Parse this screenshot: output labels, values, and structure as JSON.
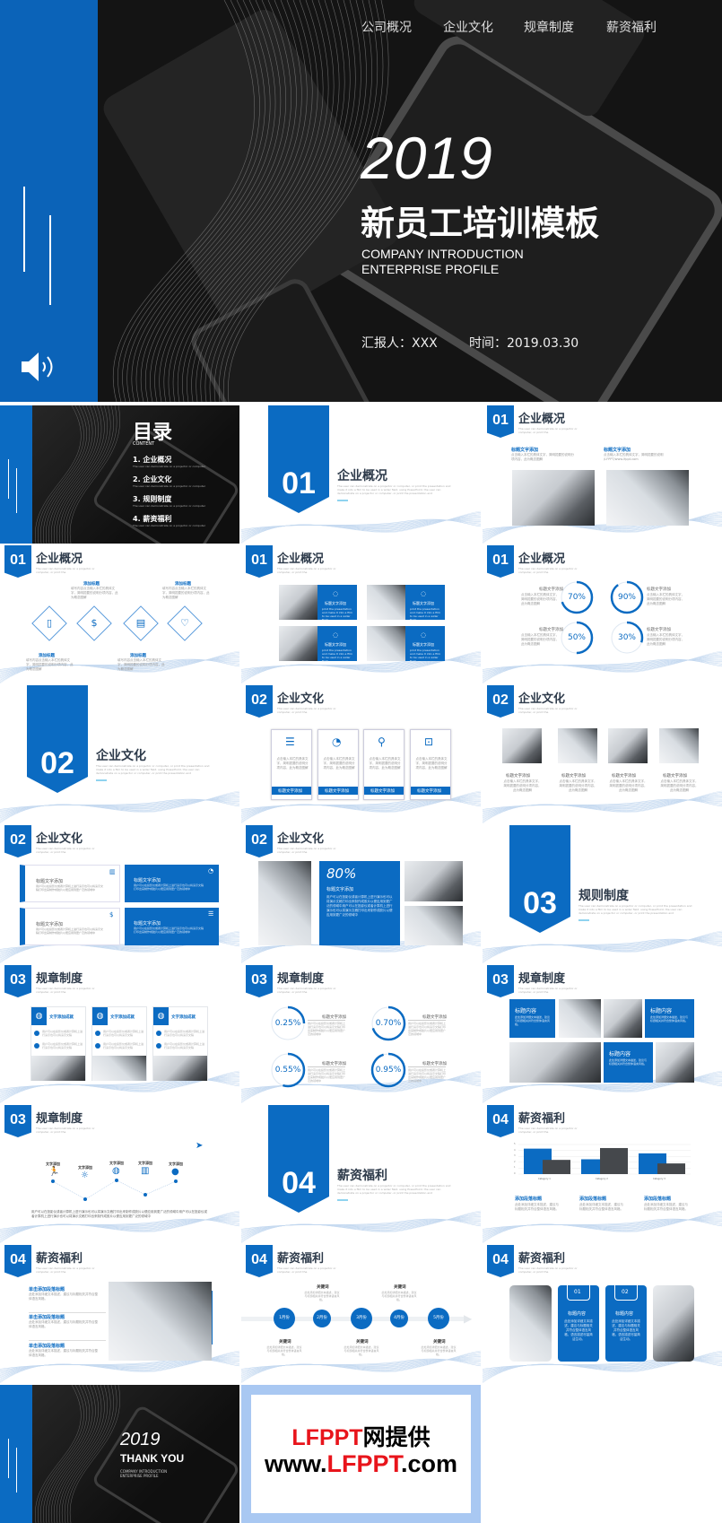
{
  "colors": {
    "accent": "#0b6bc2",
    "dark": "#141414",
    "chart_dark": "#45484c",
    "ad_red": "#e8141b",
    "ad_bg": "#a9c8f2"
  },
  "hero": {
    "nav": [
      "公司概况",
      "企业文化",
      "规章制度",
      "薪资福利"
    ],
    "year": "2019",
    "title": "新员工培训模板",
    "subtitle_1": "COMPANY INTRODUCTION",
    "subtitle_2": "ENTERPRISE PROFILE",
    "reporter": "汇报人：XXX",
    "time": "时间：2019.03.30",
    "audio_icon": "speaker-icon"
  },
  "slides": [
    {
      "type": "toc",
      "title": "目录",
      "subtitle": "CONTENT",
      "items": [
        {
          "label": "1. 企业概况",
          "desc": "The user can demonstrate on a projector or computer"
        },
        {
          "label": "2. 企业文化",
          "desc": "The user can demonstrate on a projector or computer"
        },
        {
          "label": "3. 规则制度",
          "desc": "The user can demonstrate on a projector or computer"
        },
        {
          "label": "4. 薪资福利",
          "desc": "The user can demonstrate on a projector or computer"
        }
      ]
    },
    {
      "type": "section",
      "num": "01",
      "title": "企业概况",
      "desc": "The user can demonstrate on a projector or computer, or print the presentation and make it into a film to be used in a wider field. using PowerPoint. the user can demonstrate on a projector or computer, or print the presentation and"
    },
    {
      "type": "two-col",
      "num": "01",
      "title": "企业概况",
      "subtitle": "The user can demonstrate on a projector or computer, or print the",
      "headings": [
        "标题文字添加",
        "标题文字添加"
      ],
      "texts": [
        "点击输入本栏的具体文字，简明扼要的说明分项内容，此为概念图解",
        "点击输入本栏的具体文字，简明扼要的说明 /LFPPT/www.lfppt.com"
      ]
    },
    {
      "type": "diamonds",
      "num": "01",
      "title": "企业概况",
      "subtitle": "The user can demonstrate on a projector or computer, or print the",
      "labels": [
        "添加标题",
        "添加标题",
        "添加标题",
        "添加标题"
      ],
      "text": "填写内容点击输入本栏的具体文字，简明扼要的说明分项内容，此为概念图解",
      "icons": [
        "phone-icon",
        "money-icon",
        "document-icon",
        "heart-icon"
      ]
    },
    {
      "type": "photo-boxes",
      "num": "01",
      "title": "企业概况",
      "subtitle": "The user can demonstrate on a projector or computer, or print the",
      "label": "标题文字添加",
      "text": "print the presentation and make it into a film to be used in a wider field"
    },
    {
      "type": "rings",
      "num": "01",
      "title": "企业概况",
      "subtitle": "The user can demonstrate on a projector or computer, or print the",
      "values": [
        70,
        90,
        50,
        30
      ],
      "labels": [
        "70%",
        "90%",
        "50%",
        "30%"
      ],
      "heading": "标题文字添加",
      "text": "点击输入本栏的具体文字，简明扼要的说明分项内容，此为概念图解"
    },
    {
      "type": "section",
      "num": "02",
      "title": "企业文化",
      "desc": "The user can demonstrate on a projector or computer, or print the presentation and make it into a film to be used in a wider field. using PowerPoint. the user can demonstrate on a projector or computer, or print the presentation and"
    },
    {
      "type": "cards",
      "num": "02",
      "title": "企业文化",
      "subtitle": "The user can demonstrate on a projector or computer, or print the",
      "label": "标题文字添加",
      "text": "点击输入本栏的具体文字，简明扼要的说明分项内容，此为概念图解",
      "icons": [
        "chat-icon",
        "clock-icon",
        "search-icon",
        "briefcase-icon"
      ]
    },
    {
      "type": "photo-labels",
      "num": "02",
      "title": "企业文化",
      "subtitle": "The user can demonstrate on a projector or computer, or print the",
      "label": "标题文字添加",
      "text": "点击输入本栏的具体文字，简明扼要的说明分项内容，此为概念图解"
    },
    {
      "type": "box-grid",
      "num": "02",
      "title": "企业文化",
      "subtitle": "The user can demonstrate on a projector or computer, or print the",
      "label": "标题文字添加",
      "text": "用户可以在投影仪或者计算机上进行演示也可以将演示文稿打印出来制作成胶片以便应用到更广泛的领域中"
    },
    {
      "type": "feature",
      "num": "02",
      "title": "企业文化",
      "subtitle": "The user can demonstrate on a projector or computer, or print the",
      "percent": "80%",
      "label": "标题文字添加",
      "text": "用户可以在投影仪或者计算机上进行演示也可以将演示文稿打印出来制作成胶片以便应用到更广泛的领域中用户可以在投影仪或者计算机上进行演示也可以将演示文稿打印出来制作成胶片以便应用到更广泛的领域中"
    },
    {
      "type": "section",
      "num": "03",
      "title": "规则制度",
      "desc": "The user can demonstrate on a projector or computer, or print the presentation and make it into a film to be used in a wider field. using PowerPoint. the user can demonstrate on a projector or computer, or print the presentation and"
    },
    {
      "type": "cards3",
      "num": "03",
      "title": "规章制度",
      "subtitle": "The user can demonstrate on a projector or computer, or print the",
      "labels": [
        "文字添加成就",
        "文字添加成就",
        "文字添加成就"
      ],
      "text": "用户可以在投影仪或者计算机上进行演示也可以将演示文稿"
    },
    {
      "type": "rings2",
      "num": "03",
      "title": "规章制度",
      "subtitle": "The user can demonstrate on a projector or computer, or print the",
      "values": [
        25,
        70,
        55,
        95
      ],
      "labels": [
        "0.25%",
        "0.70%",
        "0.55%",
        "0.95%"
      ],
      "heading": "标题文字添加",
      "text": "用户可以在投影仪或者计算机上进行演示也可以将演示文稿打印出来制作成胶片以便应用到更广泛的领域中"
    },
    {
      "type": "mosaic",
      "num": "03",
      "title": "规章制度",
      "subtitle": "The user can demonstrate on a projector or computer, or print the",
      "label": "标题内容",
      "text": "此处添加详细文本描述，建议与标题相关并符合整体语言风格。"
    },
    {
      "type": "timeline",
      "num": "03",
      "title": "规章制度",
      "subtitle": "The user can demonstrate on a projector or computer, or print the",
      "labels": [
        "文字添加",
        "文字添加",
        "文字添加",
        "文字添加",
        "文字添加"
      ],
      "icons": [
        "runner-icon",
        "lightbulb-icon",
        "globe-icon",
        "growth-chart-icon",
        "head-idea-icon"
      ],
      "text": "用户可以在投影仪或者计算机上进行演示也可以将演示文稿打印出来制作成胶片以便应用到更广泛的领域中用户可以在投影仪或者计算机上进行演示也可以将演示文稿打印出来制作成胶片以便应用到更广泛的领域中"
    },
    {
      "type": "section",
      "num": "04",
      "title": "薪资福利",
      "desc": "The user can demonstrate on a projector or computer, or print the presentation and make it into a film to be used in a wider field. using PowerPoint. the user can demonstrate on a projector or computer, or print the presentation and"
    },
    {
      "type": "chart",
      "num": "04",
      "title": "薪资福利",
      "subtitle": "The user can demonstrate on a projector or computer, or print the",
      "headings": [
        "添加段落标题",
        "添加段落标题",
        "添加段落标题"
      ],
      "text": "此处添加详细文本描述，建议与标题相关并符合整体语言风格。",
      "chart_data": {
        "type": "bar",
        "categories": [
          "Category 1",
          "Category 2",
          "Category 3"
        ],
        "series": [
          {
            "values": [
              4.3,
              2.5,
              3.5
            ],
            "color": "#0b6bc2"
          },
          {
            "values": [
              2.4,
              4.4,
              1.8
            ],
            "color": "#45484c"
          }
        ],
        "ylim": [
          0,
          5
        ],
        "yticks": [
          "0",
          "1",
          "2",
          "3",
          "4",
          "5"
        ],
        "grid": true
      }
    },
    {
      "type": "list-photo",
      "num": "04",
      "title": "薪资福利",
      "subtitle": "The user can demonstrate on a projector or computer, or print the",
      "headings": [
        "单击添加段落标题",
        "单击添加段落标题",
        "单击添加段落标题"
      ],
      "text": "此处添加详细文本描述，建议与标题相关并符合整体语言风格。"
    },
    {
      "type": "months",
      "num": "04",
      "title": "薪资福利",
      "subtitle": "The user can demonstrate on a projector or computer, or print the",
      "months": [
        "1月份",
        "2月份",
        "3月份",
        "4月份",
        "5月份"
      ],
      "keyword": "关键词",
      "text": "此处添加详细文本描述，建议与标题相关并符合整体语言风格。"
    },
    {
      "type": "duo",
      "num": "04",
      "title": "薪资福利",
      "subtitle": "The user can demonstrate on a projector or computer, or print the",
      "nums": [
        "01",
        "02"
      ],
      "label": "标题内容",
      "text": "此处添加详细文本描述，建议与标题相关并符合整体语言风格，语言描述尽量简洁生动。"
    },
    {
      "type": "thanks",
      "year": "2019",
      "title": "THANK YOU",
      "sub1": "COMPANY INTRODUCTION",
      "sub2": "ENTERPRISE PROFILE"
    },
    {
      "type": "ad",
      "line1_red": "LFPPT",
      "line1_black": "网提供",
      "line2_pre": "www.",
      "line2_red": "LFPPT",
      "line2_post": ".com"
    }
  ]
}
